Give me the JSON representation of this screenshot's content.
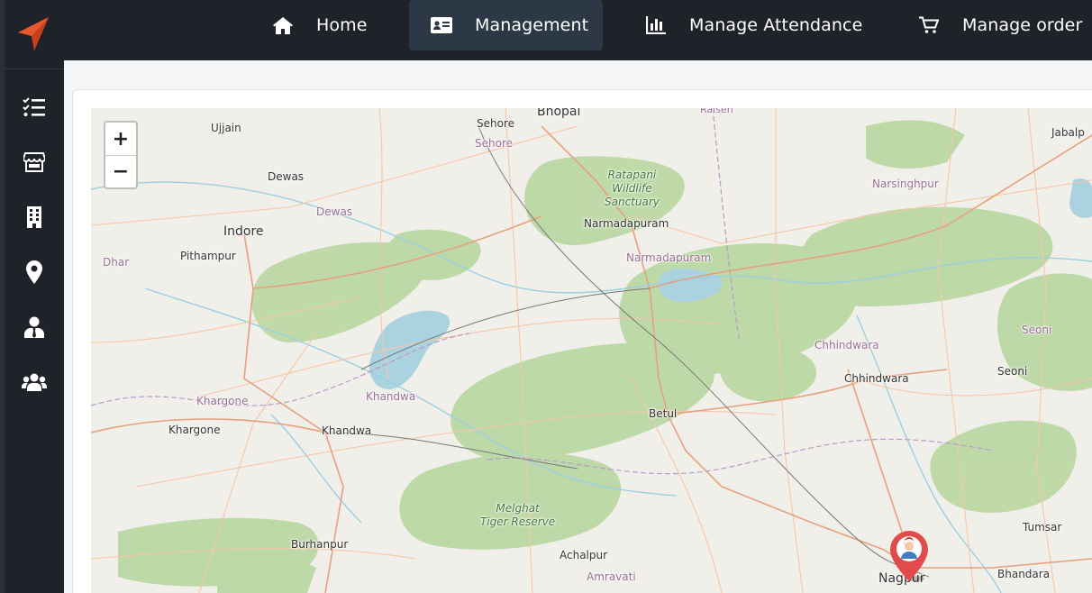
{
  "topnav": {
    "items": [
      {
        "label": "Home",
        "icon": "home-icon"
      },
      {
        "label": "Management",
        "icon": "id-card-icon",
        "active": true
      },
      {
        "label": "Manage Attendance",
        "icon": "bar-chart-icon"
      },
      {
        "label": "Manage order",
        "icon": "cart-icon"
      }
    ]
  },
  "sidebar": {
    "icons": [
      "checklist-icon",
      "store-icon",
      "building-icon",
      "location-pin-icon",
      "user-tie-icon",
      "users-icon"
    ]
  },
  "colors": {
    "navbar_bg": "#1f2329",
    "active_nav_bg": "#2d3846",
    "brand_accent": "#e8572f",
    "marker": "#e14b4b"
  },
  "map": {
    "zoom_in": "+",
    "zoom_out": "−",
    "labels": {
      "bhopal": "Bhopal",
      "sehore_city": "Sehore",
      "sehore_dist": "Sehore",
      "raisen": "Raisen",
      "jabalpur": "Jabalp",
      "ujjain": "Ujjain",
      "dewas_city": "Dewas",
      "dewas_dist": "Dewas",
      "indore": "Indore",
      "pithampur": "Pithampur",
      "dhar": "Dhar",
      "narmadapuram_city": "Narmadapuram",
      "narmadapuram_dist": "Narmadapuram",
      "narsinghpur": "Narsinghpur",
      "ratapani": "Ratapani\nWildlife\nSanctuary",
      "chhindwara_dist": "Chhindwara",
      "chhindwara_city": "Chhindwara",
      "seoni_dist": "Seoni",
      "seoni_city": "Seoni",
      "khargone_dist": "Khargone",
      "khargone_city": "Khargone",
      "khandwa_dist": "Khandwa",
      "khandwa_city": "Khandwa",
      "betul": "Betul",
      "melghat": "Melghat\nTiger Reserve",
      "burhanpur": "Burhanpur",
      "achalpur": "Achalpur",
      "amravati": "Amravati",
      "nagpur": "Nagpur",
      "tumsar": "Tumsar",
      "bhandara": "Bhandara"
    }
  }
}
